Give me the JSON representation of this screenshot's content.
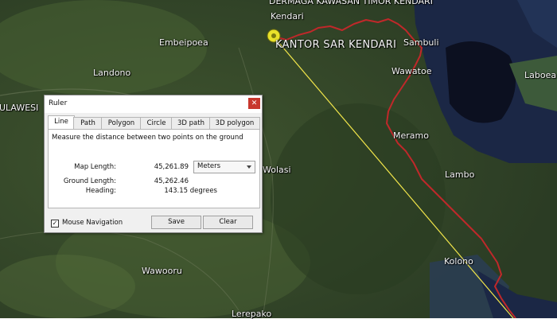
{
  "map": {
    "labels": {
      "dermaga": "DERMAGA KAWASAN TIMOR KENDARI",
      "kendari": "Kendari",
      "kantor": "KANTOR SAR KENDARI",
      "embeipoea": "Embeipoea",
      "sambuli": "Sambuli",
      "landono": "Landono",
      "wawatoe": "Wawatoe",
      "laboea": "Laboea",
      "sulawesi": "ULAWESI",
      "meramo": "Meramo",
      "wolasi": "Wolasi",
      "lambo": "Lambo",
      "kolono": "Kolono",
      "wawooru": "Wawooru",
      "lerepako": "Lerepako"
    },
    "colors": {
      "path": "#c0282a",
      "measure_line": "#f2e64a",
      "land": "#33452a",
      "sea": "#1a2540"
    }
  },
  "ruler": {
    "title": "Ruler",
    "close_icon": "close-icon",
    "tabs": [
      {
        "label": "Line",
        "active": true
      },
      {
        "label": "Path",
        "active": false
      },
      {
        "label": "Polygon",
        "active": false
      },
      {
        "label": "Circle",
        "active": false
      },
      {
        "label": "3D path",
        "active": false
      },
      {
        "label": "3D polygon",
        "active": false
      }
    ],
    "description": "Measure the distance between two points on the ground",
    "map_length_label": "Map Length:",
    "map_length_value": "45,261.89",
    "unit_selected": "Meters",
    "ground_length_label": "Ground Length:",
    "ground_length_value": "45,262.46",
    "heading_label": "Heading:",
    "heading_value": "143.15 degrees",
    "mouse_nav_label": "Mouse Navigation",
    "mouse_nav_checked": true,
    "save_label": "Save",
    "clear_label": "Clear"
  }
}
